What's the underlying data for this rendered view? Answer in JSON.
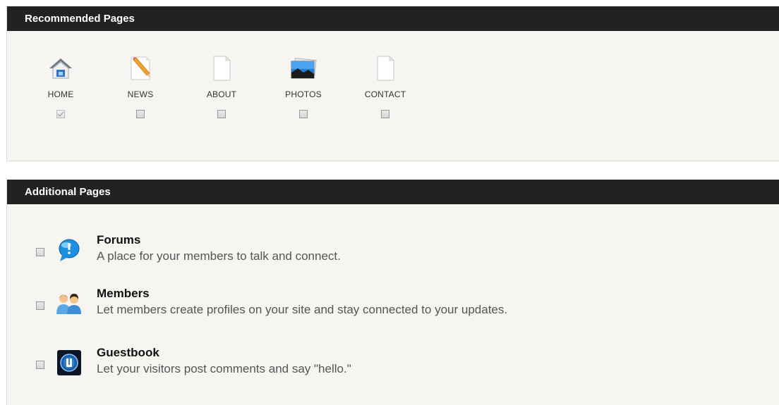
{
  "recommended": {
    "title": "Recommended Pages",
    "pages": [
      {
        "label": "HOME",
        "icon": "home-icon",
        "checked": true,
        "disabled": true
      },
      {
        "label": "NEWS",
        "icon": "pencil-note-icon",
        "checked": false,
        "disabled": false
      },
      {
        "label": "ABOUT",
        "icon": "blank-page-icon",
        "checked": false,
        "disabled": false
      },
      {
        "label": "PHOTOS",
        "icon": "photos-icon",
        "checked": false,
        "disabled": false
      },
      {
        "label": "CONTACT",
        "icon": "blank-page-icon",
        "checked": false,
        "disabled": false
      }
    ]
  },
  "additional": {
    "title": "Additional Pages",
    "items": [
      {
        "title": "Forums",
        "description": "A place for your members to talk and connect.",
        "icon": "speech-bubble-icon",
        "checked": false
      },
      {
        "title": "Members",
        "description": "Let members create profiles on your site and stay connected to your updates.",
        "icon": "members-icon",
        "checked": false
      },
      {
        "title": "Guestbook",
        "description": "Let your visitors post comments and say \"hello.\"",
        "icon": "guestbook-icon",
        "checked": false
      }
    ]
  }
}
